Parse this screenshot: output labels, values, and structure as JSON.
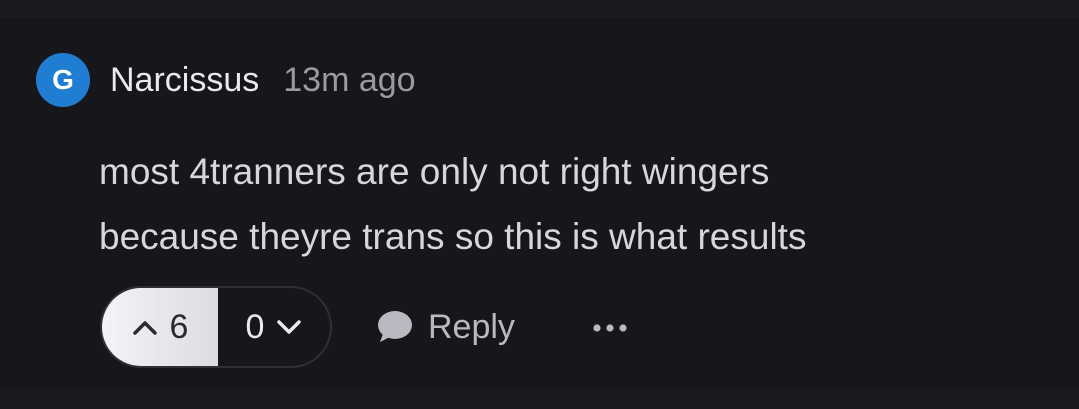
{
  "comment": {
    "avatar_letter": "G",
    "avatar_color": "#1f7ed1",
    "author": "Narcissus",
    "timestamp": "13m ago",
    "lines": [
      "most 4tranners are only not right wingers",
      "because theyre trans so this is what results"
    ]
  },
  "actions": {
    "upvote_count": "6",
    "downvote_count": "0",
    "reply_label": "Reply",
    "upvote_icon": "chevron-up-icon",
    "downvote_icon": "chevron-down-icon",
    "reply_icon": "speech-bubble-icon",
    "more_icon": "more-horizontal-icon"
  }
}
